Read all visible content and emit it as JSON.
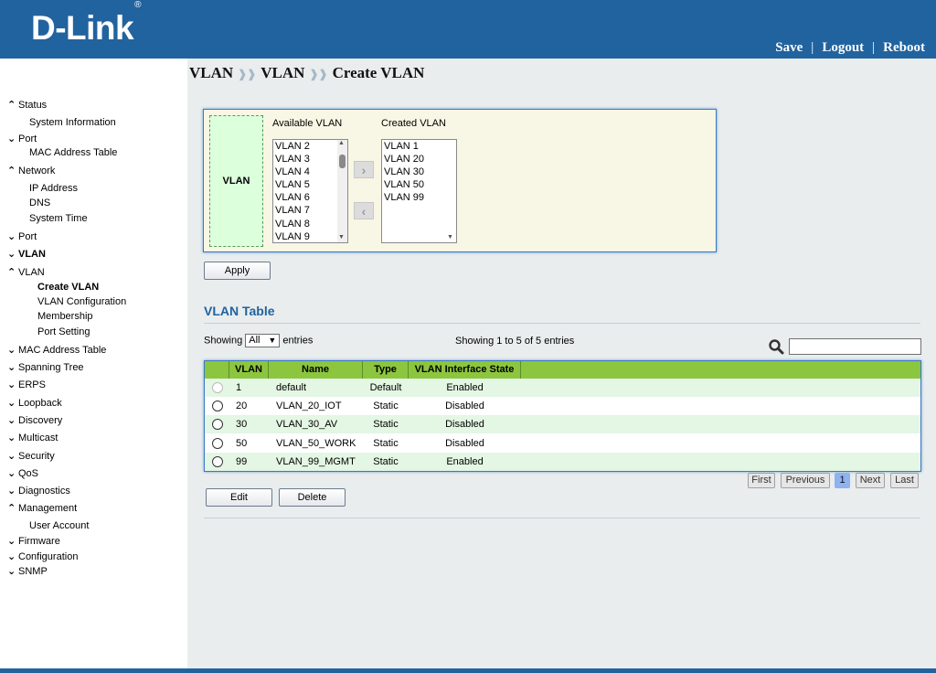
{
  "header": {
    "logo_text": "D-Link",
    "logo_mark": "®",
    "links": [
      "Save",
      "Logout",
      "Reboot"
    ]
  },
  "sidebar": {
    "items": [
      {
        "label": "Status",
        "arrow": "up"
      },
      {
        "label": "System Information"
      },
      {
        "label": "Port",
        "arrow": "down"
      },
      {
        "label": "MAC Address Table"
      },
      {
        "label": "Network",
        "arrow": "up"
      },
      {
        "label": "IP Address"
      },
      {
        "label": "DNS"
      },
      {
        "label": "System Time"
      },
      {
        "label": "Port",
        "arrow": "down"
      },
      {
        "label": "VLAN",
        "arrow": "down",
        "bold": true
      },
      {
        "label": "VLAN",
        "arrow": "up"
      },
      {
        "label": "Create VLAN",
        "bold": true
      },
      {
        "label": "VLAN Configuration"
      },
      {
        "label": "Membership"
      },
      {
        "label": "Port Setting"
      },
      {
        "label": "MAC Address Table",
        "arrow": "down"
      },
      {
        "label": "Spanning Tree",
        "arrow": "down"
      },
      {
        "label": "ERPS",
        "arrow": "down"
      },
      {
        "label": "Loopback",
        "arrow": "down"
      },
      {
        "label": "Discovery",
        "arrow": "down"
      },
      {
        "label": "Multicast",
        "arrow": "down"
      },
      {
        "label": "Security",
        "arrow": "down"
      },
      {
        "label": "QoS",
        "arrow": "down"
      },
      {
        "label": "Diagnostics",
        "arrow": "down"
      },
      {
        "label": "Management",
        "arrow": "up"
      },
      {
        "label": "User Account"
      },
      {
        "label": "Firmware",
        "arrow": "down"
      },
      {
        "label": "Configuration",
        "arrow": "down"
      },
      {
        "label": "SNMP",
        "arrow": "down"
      }
    ]
  },
  "breadcrumb": [
    "VLAN",
    "VLAN",
    "Create VLAN"
  ],
  "create_panel": {
    "label": "VLAN",
    "available_title": "Available VLAN",
    "created_title": "Created VLAN",
    "available": [
      "VLAN 2",
      "VLAN 3",
      "VLAN 4",
      "VLAN 5",
      "VLAN 6",
      "VLAN 7",
      "VLAN 8",
      "VLAN 9"
    ],
    "created": [
      "VLAN 1",
      "VLAN 20",
      "VLAN 30",
      "VLAN 50",
      "VLAN 99"
    ],
    "apply_label": "Apply"
  },
  "table_section": {
    "title": "VLAN Table",
    "showing_prefix": "Showing",
    "page_size": "All",
    "showing_suffix": "entries",
    "summary": "Showing 1 to 5 of 5 entries",
    "columns": [
      "VLAN",
      "Name",
      "Type",
      "VLAN Interface State"
    ],
    "rows": [
      {
        "vlan": "1",
        "name": "default",
        "type": "Default",
        "state": "Enabled"
      },
      {
        "vlan": "20",
        "name": "VLAN_20_IOT",
        "type": "Static",
        "state": "Disabled"
      },
      {
        "vlan": "30",
        "name": "VLAN_30_AV",
        "type": "Static",
        "state": "Disabled"
      },
      {
        "vlan": "50",
        "name": "VLAN_50_WORK",
        "type": "Static",
        "state": "Disabled"
      },
      {
        "vlan": "99",
        "name": "VLAN_99_MGMT",
        "type": "Static",
        "state": "Enabled"
      }
    ],
    "pager": {
      "first": "First",
      "previous": "Previous",
      "current": "1",
      "next": "Next",
      "last": "Last"
    },
    "edit_label": "Edit",
    "delete_label": "Delete"
  }
}
